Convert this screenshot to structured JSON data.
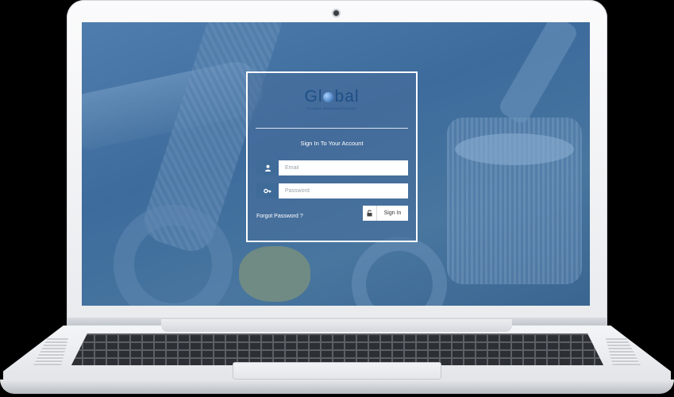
{
  "login": {
    "logo": {
      "wordmark": "Global",
      "tagline": "GLOBAL MANUFACTURING"
    },
    "heading": "Sign In To Your Account",
    "email_placeholder": "Email",
    "password_placeholder": "Password",
    "forgot_link": "Forgot Password ?",
    "signin_label": "Sign In"
  },
  "icons": {
    "email": "user-icon",
    "password": "key-icon",
    "signin": "unlock-icon"
  },
  "colors": {
    "screen_tint": "#4a78a6",
    "field_icon_bg": "#3f6b98",
    "logo_blue": "#1d4f86",
    "frame": "#ffffff"
  }
}
